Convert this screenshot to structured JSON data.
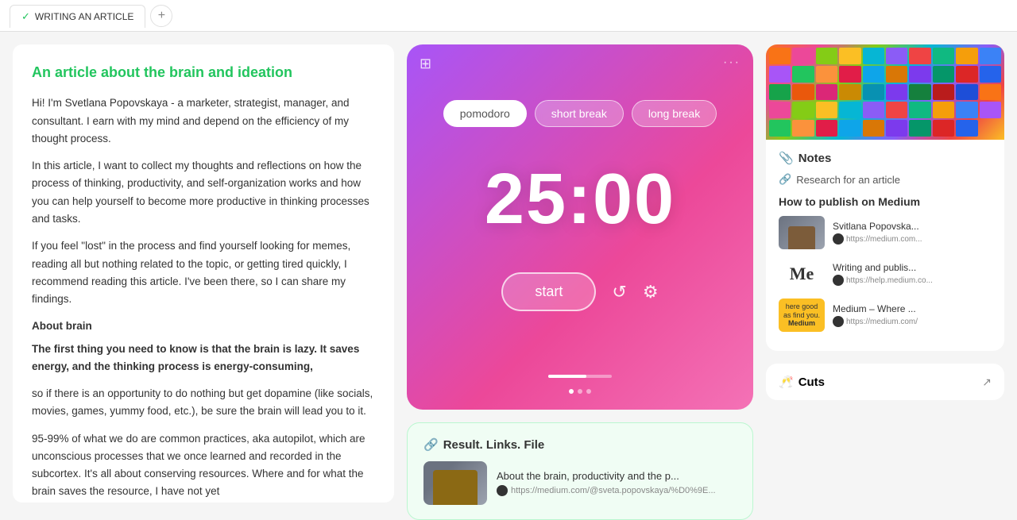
{
  "tab": {
    "label": "WRITING AN ARTICLE",
    "add_label": "+"
  },
  "article": {
    "title": "An article about the brain and ideation",
    "paragraphs": [
      "Hi! I'm Svetlana Popovskaya - a marketer, strategist, manager, and consultant. I earn with my mind and depend on the efficiency of my thought process.",
      "In this article, I want to collect my thoughts and reflections on how the process of thinking, productivity, and self-organization works and how you can help yourself to become more productive in thinking processes and tasks.",
      "If you feel \"lost\" in the process and find yourself looking for memes, reading all but nothing related to the topic, or getting tired quickly, I recommend reading this article. I've been there, so I can share my findings.",
      "About brain",
      "The first thing you need to know is that the brain is lazy. It saves energy, and the thinking process is energy-consuming,",
      "so if there is an opportunity to do nothing but get dopamine (like socials, movies, games, yummy food, etc.), be sure the brain will lead you to it.",
      "95-99% of what we do are common practices, aka autopilot, which are unconscious processes that we once learned and recorded in the subcortex. It's all about conserving resources. Where and for what the brain saves the resource, I have not yet"
    ]
  },
  "pomodoro": {
    "dots": "···",
    "grid_icon": "⊞",
    "tabs": [
      {
        "label": "pomodoro",
        "active": true
      },
      {
        "label": "short break",
        "active": false
      },
      {
        "label": "long break",
        "active": false
      }
    ],
    "timer": "25:00",
    "start_label": "start",
    "reset_icon": "↺",
    "settings_icon": "⚙"
  },
  "result": {
    "header_icon": "🔗",
    "header_label": "Result. Links. File",
    "card_title": "About the brain, productivity and the p...",
    "card_link": "https://medium.com/@sveta.popovskaya/%D0%9E..."
  },
  "notes": {
    "icon": "📎",
    "title": "Notes",
    "link_icon": "🔗",
    "link_label": "Research for an article",
    "section_title": "How to publish on Medium",
    "cards": [
      {
        "title": "Svitlana Popovska...",
        "link": "https://medium.com...",
        "thumb_type": "person"
      },
      {
        "title": "Writing and publis...",
        "link": "https://help.medium.co...",
        "thumb_type": "medium-logo"
      },
      {
        "title": "Medium – Where ...",
        "link": "https://medium.com/",
        "thumb_type": "medium-yellow"
      }
    ]
  },
  "cuts": {
    "icon": "🥂",
    "label": "Cuts",
    "expand_icon": "↗"
  }
}
